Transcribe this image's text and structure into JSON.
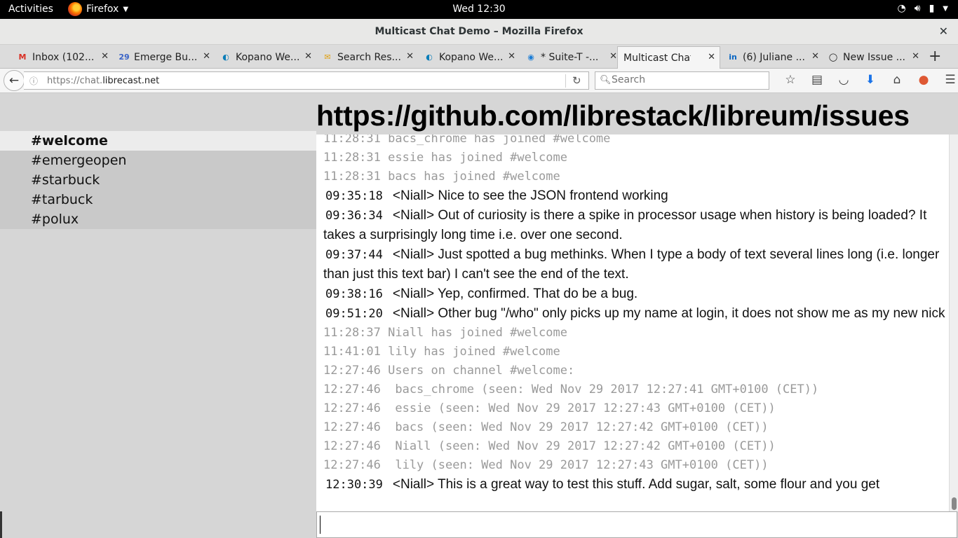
{
  "topbar": {
    "activities": "Activities",
    "app_name": "Firefox",
    "clock": "Wed 12:30"
  },
  "window": {
    "title": "Multicast Chat Demo – Mozilla Firefox"
  },
  "tabs": [
    {
      "label": "Inbox (102...",
      "icon": "gmail-icon",
      "icon_text": "M",
      "color": "#d93025"
    },
    {
      "label": "Emerge Bu...",
      "icon": "calendar-icon",
      "icon_text": "29",
      "color": "#3a63c7"
    },
    {
      "label": "Kopano We...",
      "icon": "kopano-icon",
      "icon_text": "◐",
      "color": "#0a7db8"
    },
    {
      "label": "Search Res...",
      "icon": "envelope-icon",
      "icon_text": "✉",
      "color": "#e0a010"
    },
    {
      "label": "Kopano We...",
      "icon": "kopano-icon",
      "icon_text": "◐",
      "color": "#0a7db8"
    },
    {
      "label": "* Suite-T -...",
      "icon": "suite-icon",
      "icon_text": "◉",
      "color": "#1a7cd6"
    },
    {
      "label": "Multicast Chat...",
      "icon": "",
      "icon_text": "",
      "color": "",
      "active": true
    },
    {
      "label": "(6) Juliane ...",
      "icon": "linkedin-icon",
      "icon_text": "in",
      "color": "#0a66c2"
    },
    {
      "label": "New Issue ...",
      "icon": "github-icon",
      "icon_text": "◯",
      "color": "#111"
    }
  ],
  "nav": {
    "url_prefix": "https://chat.",
    "url_domain": "librecast.net",
    "search_placeholder": "Search"
  },
  "page": {
    "heading": "https://github.com/librestack/libreum/issues"
  },
  "channels": [
    {
      "name": "#welcome",
      "active": true
    },
    {
      "name": "#emergeopen"
    },
    {
      "name": "#starbuck"
    },
    {
      "name": "#tarbuck"
    },
    {
      "name": "#polux"
    }
  ],
  "messages": [
    {
      "type": "sys",
      "text": "11:28:31 bacs_chrome has joined #welcome"
    },
    {
      "type": "sys",
      "text": "11:28:31 essie has joined #welcome"
    },
    {
      "type": "sys",
      "text": "11:28:31 bacs has joined #welcome"
    },
    {
      "type": "msg",
      "time": "09:35:18",
      "text": "<Niall> Nice to see the JSON frontend working"
    },
    {
      "type": "msg",
      "time": "09:36:34",
      "text": "<Niall> Out of curiosity is there a spike in processor usage when history is being loaded? It takes a surprisingly long time i.e. over one second."
    },
    {
      "type": "msg",
      "time": "09:37:44",
      "text": "<Niall> Just spotted a bug methinks. When I type a body of text several lines long (i.e. longer than just this text bar) I can't see the end of the text."
    },
    {
      "type": "msg",
      "time": "09:38:16",
      "text": "<Niall> Yep, confirmed. That do be a bug."
    },
    {
      "type": "msg",
      "time": "09:51:20",
      "text": "<Niall> Other bug \"/who\" only picks up my name at login, it does not show me as my new nick"
    },
    {
      "type": "sys",
      "text": "11:28:37 Niall has joined #welcome"
    },
    {
      "type": "sys",
      "text": "11:41:01 lily has joined #welcome"
    },
    {
      "type": "sys",
      "text": "12:27:46 Users on channel #welcome:"
    },
    {
      "type": "sys",
      "text": "12:27:46  bacs_chrome (seen: Wed Nov 29 2017 12:27:41 GMT+0100 (CET))"
    },
    {
      "type": "sys",
      "text": "12:27:46  essie (seen: Wed Nov 29 2017 12:27:43 GMT+0100 (CET))"
    },
    {
      "type": "sys",
      "text": "12:27:46  bacs (seen: Wed Nov 29 2017 12:27:42 GMT+0100 (CET))"
    },
    {
      "type": "sys",
      "text": "12:27:46  Niall (seen: Wed Nov 29 2017 12:27:42 GMT+0100 (CET))"
    },
    {
      "type": "sys",
      "text": "12:27:46  lily (seen: Wed Nov 29 2017 12:27:43 GMT+0100 (CET))"
    },
    {
      "type": "msg",
      "time": "12:30:39",
      "text": "<Niall> This is a great way to test this stuff. Add sugar, salt, some flour and you get"
    }
  ],
  "colors": {
    "sidebar_bg": "#c9c9c9",
    "active_channel_bg": "#ececec",
    "system_text": "#9a9a9a"
  }
}
